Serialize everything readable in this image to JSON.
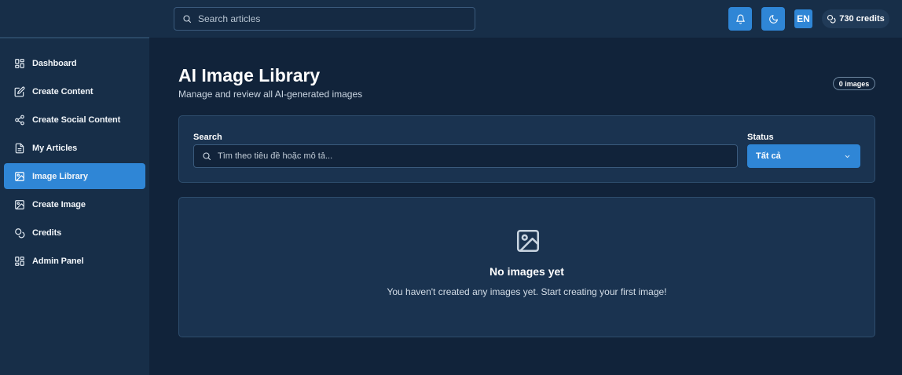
{
  "header": {
    "search_placeholder": "Search articles",
    "language": "EN",
    "credits": "730 credits"
  },
  "sidebar": {
    "items": [
      {
        "label": "Dashboard",
        "icon": "dashboard-icon"
      },
      {
        "label": "Create Content",
        "icon": "edit-icon"
      },
      {
        "label": "Create Social Content",
        "icon": "share-icon"
      },
      {
        "label": "My Articles",
        "icon": "document-icon"
      },
      {
        "label": "Image Library",
        "icon": "image-icon",
        "active": true
      },
      {
        "label": "Create Image",
        "icon": "image-plus-icon"
      },
      {
        "label": "Credits",
        "icon": "coins-icon"
      },
      {
        "label": "Admin Panel",
        "icon": "admin-grid-icon"
      }
    ]
  },
  "main": {
    "title": "AI Image Library",
    "subtitle": "Manage and review all AI-generated images",
    "image_count": "0 images",
    "filters": {
      "search_label": "Search",
      "search_placeholder": "Tìm theo tiêu đề hoặc mô tả...",
      "status_label": "Status",
      "status_value": "Tất cả"
    },
    "empty_state": {
      "title": "No images yet",
      "description": "You haven't created any images yet. Start creating your first image!"
    }
  },
  "colors": {
    "accent": "#2f86d6",
    "background": "#11233a",
    "panel": "#172e48",
    "card": "#1a3350"
  }
}
